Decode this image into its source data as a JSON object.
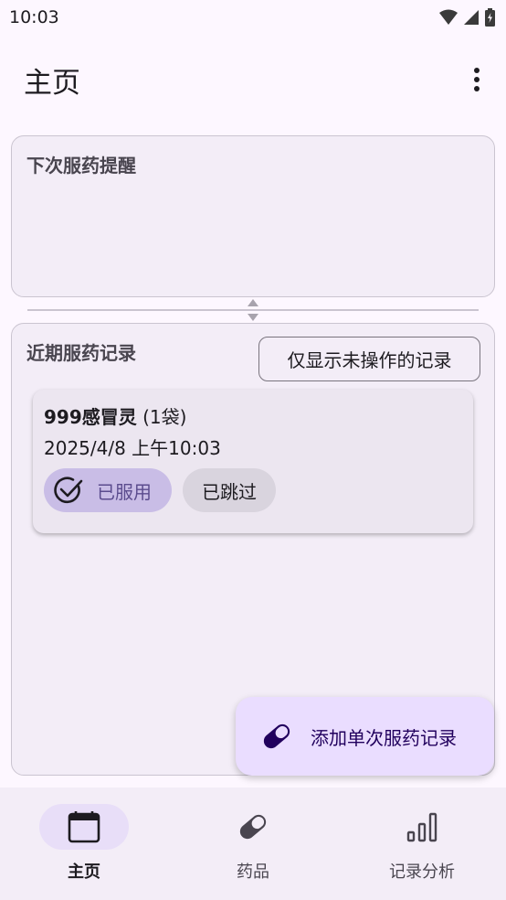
{
  "status_bar": {
    "time": "10:03",
    "icons": [
      "wifi-icon",
      "signal-icon",
      "battery-charging-icon"
    ]
  },
  "app_bar": {
    "title": "主页",
    "more_icon": "more-vert-icon"
  },
  "next_reminder": {
    "title": "下次服药提醒"
  },
  "recent_records": {
    "title": "近期服药记录",
    "filter_label": "仅显示未操作的记录",
    "items": [
      {
        "name": "999感冒灵",
        "dose": "(1袋)",
        "time": "2025/4/8 上午10:03",
        "taken_label": "已服用",
        "skipped_label": "已跳过"
      }
    ]
  },
  "fab": {
    "label": "添加单次服药记录",
    "icon": "pill-icon"
  },
  "bottom_nav": {
    "items": [
      {
        "label": "主页",
        "icon": "calendar-icon",
        "active": true
      },
      {
        "label": "药品",
        "icon": "pill-icon",
        "active": false
      },
      {
        "label": "记录分析",
        "icon": "bar-chart-icon",
        "active": false
      }
    ]
  },
  "colors": {
    "background": "#fdf7ff",
    "surface": "#f3edf7",
    "primary_container": "#eaddff",
    "taken_chip": "#c9bde6",
    "skip_chip": "#d9d4de"
  }
}
